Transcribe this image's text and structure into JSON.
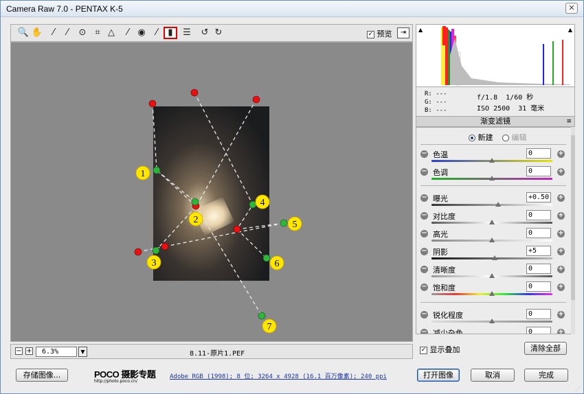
{
  "window": {
    "title": "Camera Raw 7.0 -  PENTAX K-5",
    "close_label": "✕"
  },
  "toolbar": {
    "tools": [
      {
        "name": "zoom-tool",
        "glyph": "🔍"
      },
      {
        "name": "hand-tool",
        "glyph": "✋"
      },
      {
        "name": "white-balance-tool",
        "glyph": "⁄"
      },
      {
        "name": "color-sampler-tool",
        "glyph": "⁄"
      },
      {
        "name": "targeted-adjustment-tool",
        "glyph": "⊙"
      },
      {
        "name": "crop-tool",
        "glyph": "⌗"
      },
      {
        "name": "straighten-tool",
        "glyph": "△"
      },
      {
        "name": "spot-removal-tool",
        "glyph": "⁄"
      },
      {
        "name": "red-eye-tool",
        "glyph": "◉"
      },
      {
        "name": "adjustment-brush-tool",
        "glyph": "⁄"
      },
      {
        "name": "graduated-filter-tool",
        "glyph": "▮"
      },
      {
        "name": "preferences-tool",
        "glyph": "☰"
      },
      {
        "name": "rotate-ccw-tool",
        "glyph": "↺"
      },
      {
        "name": "rotate-cw-tool",
        "glyph": "↻"
      }
    ],
    "preview_label": "预览",
    "preview_checked": "✓"
  },
  "canvas": {
    "markers": [
      "1",
      "2",
      "3",
      "4",
      "5",
      "6",
      "7"
    ]
  },
  "statusbar": {
    "zoom_minus": "−",
    "zoom_plus": "+",
    "zoom_value": "6.3%",
    "filename": "8.11-原片1.PEF"
  },
  "histogram": {
    "readout_rgb": [
      "R:  ---",
      "G:  ---",
      "B:  ---"
    ],
    "aperture": "f/1.8",
    "shutter": "1/60 秒",
    "iso": "ISO 2500",
    "focal": "31 毫米"
  },
  "panel": {
    "title": "渐变滤镜",
    "menu_icon": "≡",
    "mode_new": "新建",
    "mode_edit": "编辑",
    "sliders": [
      {
        "label": "色温",
        "value": "0",
        "pos": 0.5,
        "track": "linear-gradient(90deg,#2b3fd8,#e8e600)"
      },
      {
        "label": "色调",
        "value": "0",
        "pos": 0.5,
        "track": "linear-gradient(90deg,#22b022,#c024c0)"
      },
      {
        "label": "曝光",
        "value": "+0.50",
        "pos": 0.55,
        "track": "linear-gradient(90deg,#333,#fff)"
      },
      {
        "label": "对比度",
        "value": "0",
        "pos": 0.5,
        "track": "linear-gradient(90deg,#555,#fff,#555)"
      },
      {
        "label": "高光",
        "value": "0",
        "pos": 0.5,
        "track": "linear-gradient(90deg,#888,#fff)"
      },
      {
        "label": "阴影",
        "value": "+5",
        "pos": 0.52,
        "track": "linear-gradient(90deg,#111,#bbb)"
      },
      {
        "label": "清晰度",
        "value": "0",
        "pos": 0.5,
        "track": "linear-gradient(90deg,#999,#fff,#555)"
      },
      {
        "label": "饱和度",
        "value": "0",
        "pos": 0.5,
        "track": "linear-gradient(90deg,#999,#e33,#ee3,#3e3,#33e,#e3e)"
      },
      {
        "label": "锐化程度",
        "value": "0",
        "pos": 0.5,
        "track": "linear-gradient(90deg,#ddd,#888)"
      },
      {
        "label": "减少杂色",
        "value": "0",
        "pos": 0.5,
        "track": "linear-gradient(90deg,#ddd,#888)"
      }
    ],
    "overlay_label": "显示叠加",
    "overlay_checked": "✓",
    "clear_all_label": "清除全部"
  },
  "bottom": {
    "save_label": "存储图像...",
    "logo_main": "POCO 摄影专题",
    "logo_url": "http://photo.poco.cn/",
    "workflow": "Adobe RGB (1998); 8 位; 3264 x 4928 (16.1 百万像素); 240 ppi",
    "open_label": "打开图像",
    "cancel_label": "取消",
    "done_label": "完成"
  }
}
